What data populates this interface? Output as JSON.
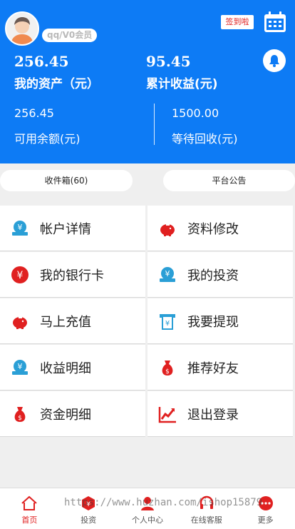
{
  "header": {
    "member_badge": "qq/V0会员",
    "sign_button": "签到啦",
    "total_assets_value": "256.45",
    "total_assets_label": "我的资产（元）",
    "total_earnings_value": "95.45",
    "total_earnings_label": "累计收益(元)",
    "available_value": "256.45",
    "available_label": "可用余额(元)",
    "pending_value": "1500.00",
    "pending_label": "等待回收(元)"
  },
  "pills": {
    "inbox": "收件箱(60)",
    "notice": "平台公告"
  },
  "menu": [
    {
      "label": "帐户详情",
      "icon": "yuan-card-icon"
    },
    {
      "label": "资料修改",
      "icon": "piggy-bank-icon"
    },
    {
      "label": "我的银行卡",
      "icon": "yuan-coin-icon"
    },
    {
      "label": "我的投资",
      "icon": "yuan-card-icon"
    },
    {
      "label": "马上充值",
      "icon": "piggy-bank-icon"
    },
    {
      "label": "我要提现",
      "icon": "atm-receipt-icon"
    },
    {
      "label": "收益明细",
      "icon": "yuan-card-icon"
    },
    {
      "label": "推荐好友",
      "icon": "money-bag-icon"
    },
    {
      "label": "资金明细",
      "icon": "money-bag-icon"
    },
    {
      "label": "退出登录",
      "icon": "trend-chart-icon"
    }
  ],
  "nav": [
    {
      "label": "首页",
      "icon": "home-icon"
    },
    {
      "label": "投资",
      "icon": "invest-icon"
    },
    {
      "label": "个人中心",
      "icon": "user-icon"
    },
    {
      "label": "在线客服",
      "icon": "headset-icon"
    },
    {
      "label": "更多",
      "icon": "more-icon"
    }
  ],
  "watermark": "https://www.huzhan.com/ishop15879",
  "colors": {
    "brand_blue": "#0d7bf5",
    "accent_red": "#e02020",
    "icon_blue": "#2a9fd6"
  }
}
